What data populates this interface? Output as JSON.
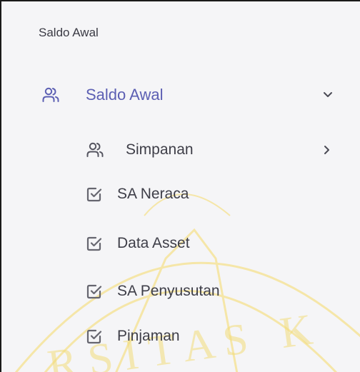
{
  "sidebar": {
    "section_header": "Saldo Awal",
    "parent": {
      "label": "Saldo Awal",
      "icon": "users-icon",
      "state": "expanded",
      "accent_color": "#5c5fb3"
    },
    "children": [
      {
        "label": "Simpanan",
        "icon": "users-icon",
        "has_submenu": true
      },
      {
        "label": "SA Neraca",
        "icon": "checkbox-icon"
      },
      {
        "label": "Data Asset",
        "icon": "checkbox-icon"
      },
      {
        "label": "SA Penyusutan",
        "icon": "checkbox-icon"
      },
      {
        "label": "Pinjaman",
        "icon": "checkbox-icon"
      }
    ]
  },
  "watermark": {
    "text": "RSITAS K",
    "color": "#f2dc7a"
  }
}
